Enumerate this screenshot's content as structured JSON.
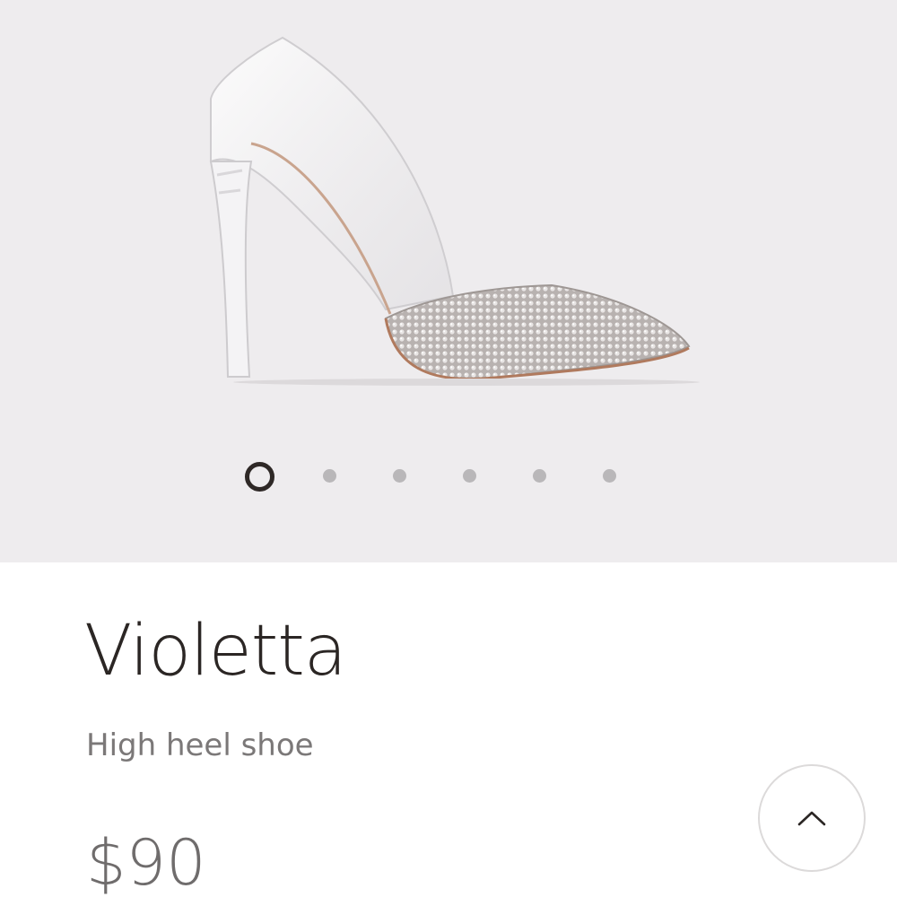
{
  "gallery": {
    "image_alt": "Violetta high heel shoe",
    "slide_count": 6,
    "active_slide": 1,
    "background": "#eeecee"
  },
  "product": {
    "name": "Violetta",
    "subtitle": "High heel shoe",
    "price": "$90"
  },
  "controls": {
    "scroll_top_icon": "chevron-up-icon"
  },
  "colors": {
    "text_primary": "#2b2624",
    "text_secondary": "#7b7878",
    "dot_inactive": "#b9b7b9",
    "dot_active": "#2e2826"
  }
}
